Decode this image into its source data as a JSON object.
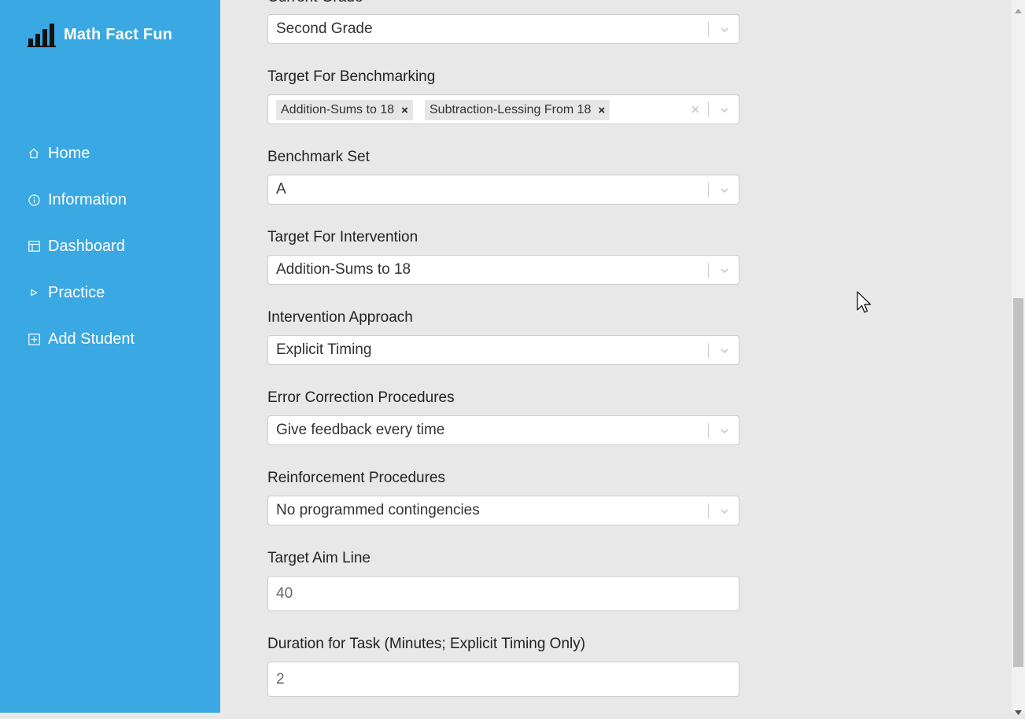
{
  "app": {
    "brand_name": "Math Fact Fun",
    "brand_icon": "bar-chart-icon",
    "accent_color": "#3aa8e2"
  },
  "sidebar": {
    "items": [
      {
        "label": "Home",
        "icon": "home-icon"
      },
      {
        "label": "Information",
        "icon": "info-icon"
      },
      {
        "label": "Dashboard",
        "icon": "table-icon"
      },
      {
        "label": "Practice",
        "icon": "play-icon"
      },
      {
        "label": "Add Student",
        "icon": "plus-square-icon"
      }
    ]
  },
  "form": {
    "current_grade": {
      "label": "Current Grade",
      "value": "Second Grade"
    },
    "target_benchmarking": {
      "label": "Target For Benchmarking",
      "tags": [
        "Addition-Sums to 18",
        "Subtraction-Lessing From 18"
      ],
      "remove_glyph": "×"
    },
    "benchmark_set": {
      "label": "Benchmark Set",
      "value": "A"
    },
    "target_intervention": {
      "label": "Target For Intervention",
      "value": "Addition-Sums to 18"
    },
    "intervention_approach": {
      "label": "Intervention Approach",
      "value": "Explicit Timing"
    },
    "error_correction": {
      "label": "Error Correction Procedures",
      "value": "Give feedback every time"
    },
    "reinforcement": {
      "label": "Reinforcement Procedures",
      "value": "No programmed contingencies"
    },
    "target_aim_line": {
      "label": "Target Aim Line",
      "value": "40"
    },
    "duration": {
      "label": "Duration for Task (Minutes; Explicit Timing Only)",
      "value": "2"
    }
  }
}
